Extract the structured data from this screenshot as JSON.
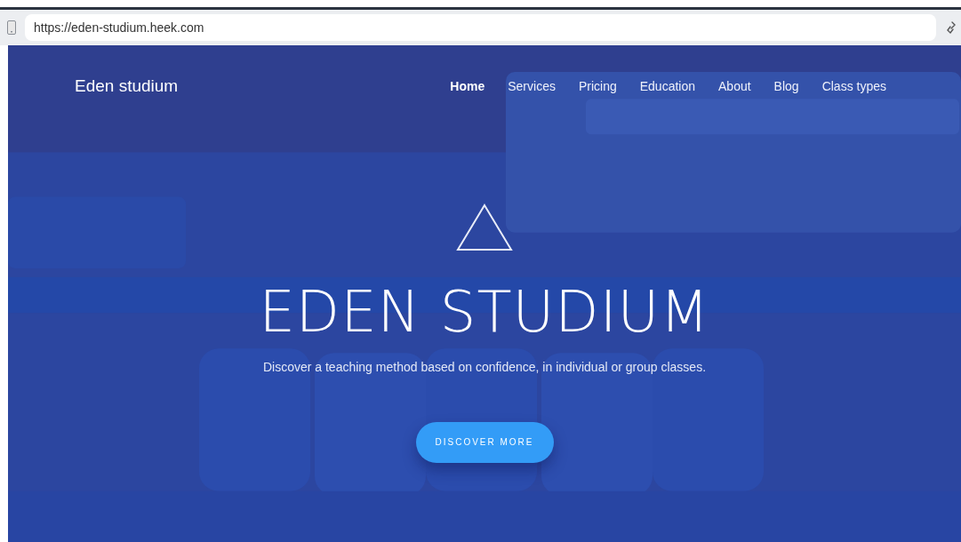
{
  "browser": {
    "url": "https://eden-studium.heek.com"
  },
  "site": {
    "logo": "Eden studium"
  },
  "nav": [
    {
      "label": "Home",
      "selected": true
    },
    {
      "label": "Services",
      "selected": false
    },
    {
      "label": "Pricing",
      "selected": false
    },
    {
      "label": "Education",
      "selected": false
    },
    {
      "label": "About",
      "selected": false
    },
    {
      "label": "Blog",
      "selected": false
    },
    {
      "label": "Class types",
      "selected": false
    }
  ],
  "hero": {
    "title": "EDEN STUDIUM",
    "subtitle": "Discover a teaching method based on confidence, in individual or group classes.",
    "button": "DISCOVER MORE"
  }
}
